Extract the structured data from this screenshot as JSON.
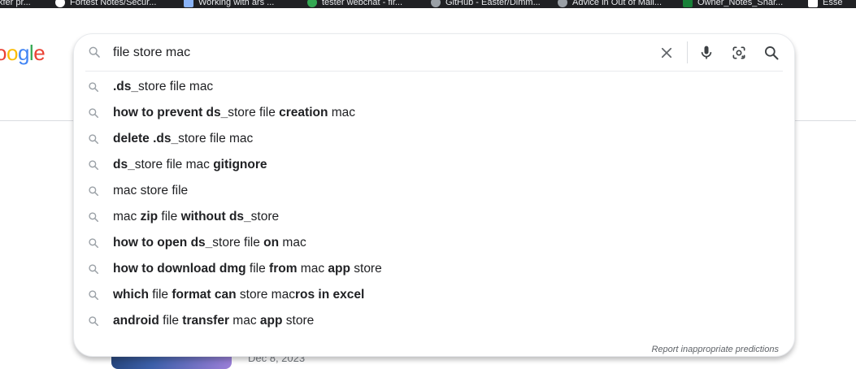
{
  "colors": {
    "google_blue": "#4285F4",
    "google_red": "#EA4335",
    "google_yellow": "#FBBC05",
    "google_green": "#34A853",
    "icon_gray": "#5f6368",
    "text": "#202124"
  },
  "bookmarks": [
    "kfer pr...",
    "Fortest Notes/Secur...",
    "Working with ars ... ",
    "tester webchat - fir...",
    "GitHub - Easter/Dimm...",
    "Advice in Out of Mail...",
    "Owner_Notes_Shar...",
    "Esse"
  ],
  "logo": {
    "letters": [
      "o",
      "o",
      "g",
      "l",
      "e"
    ]
  },
  "search": {
    "query": "file store mac",
    "clear_icon": "close-icon",
    "voice_icon": "mic-icon",
    "lens_icon": "camera-lens-icon",
    "search_icon": "search-icon",
    "suggestions": [
      [
        {
          "t": ".ds_",
          "b": true
        },
        {
          "t": "store file mac",
          "b": false
        }
      ],
      [
        {
          "t": "how to prevent ds_",
          "b": true
        },
        {
          "t": "store file ",
          "b": false
        },
        {
          "t": "creation",
          "b": true
        },
        {
          "t": " mac",
          "b": false
        }
      ],
      [
        {
          "t": "delete .ds_",
          "b": true
        },
        {
          "t": "store file mac",
          "b": false
        }
      ],
      [
        {
          "t": "ds_",
          "b": true
        },
        {
          "t": "store file mac ",
          "b": false
        },
        {
          "t": "gitignore",
          "b": true
        }
      ],
      [
        {
          "t": "mac store file",
          "b": false
        }
      ],
      [
        {
          "t": "mac ",
          "b": false
        },
        {
          "t": "zip",
          "b": true
        },
        {
          "t": " file ",
          "b": false
        },
        {
          "t": "without ds_",
          "b": true
        },
        {
          "t": "store",
          "b": false
        }
      ],
      [
        {
          "t": "how to open ds_",
          "b": true
        },
        {
          "t": "store file ",
          "b": false
        },
        {
          "t": "on",
          "b": true
        },
        {
          "t": " mac",
          "b": false
        }
      ],
      [
        {
          "t": "how to download dmg",
          "b": true
        },
        {
          "t": " file ",
          "b": false
        },
        {
          "t": "from",
          "b": true
        },
        {
          "t": " mac ",
          "b": false
        },
        {
          "t": "app",
          "b": true
        },
        {
          "t": " store",
          "b": false
        }
      ],
      [
        {
          "t": "which",
          "b": true
        },
        {
          "t": " file ",
          "b": false
        },
        {
          "t": "format can",
          "b": true
        },
        {
          "t": " store mac",
          "b": false
        },
        {
          "t": "ros in excel",
          "b": true
        }
      ],
      [
        {
          "t": "android",
          "b": true
        },
        {
          "t": " file ",
          "b": false
        },
        {
          "t": "transfer",
          "b": true
        },
        {
          "t": " mac ",
          "b": false
        },
        {
          "t": "app",
          "b": true
        },
        {
          "t": " store",
          "b": false
        }
      ]
    ],
    "report_link": "Report inappropriate predictions"
  },
  "result": {
    "date": "Dec 8, 2023"
  }
}
